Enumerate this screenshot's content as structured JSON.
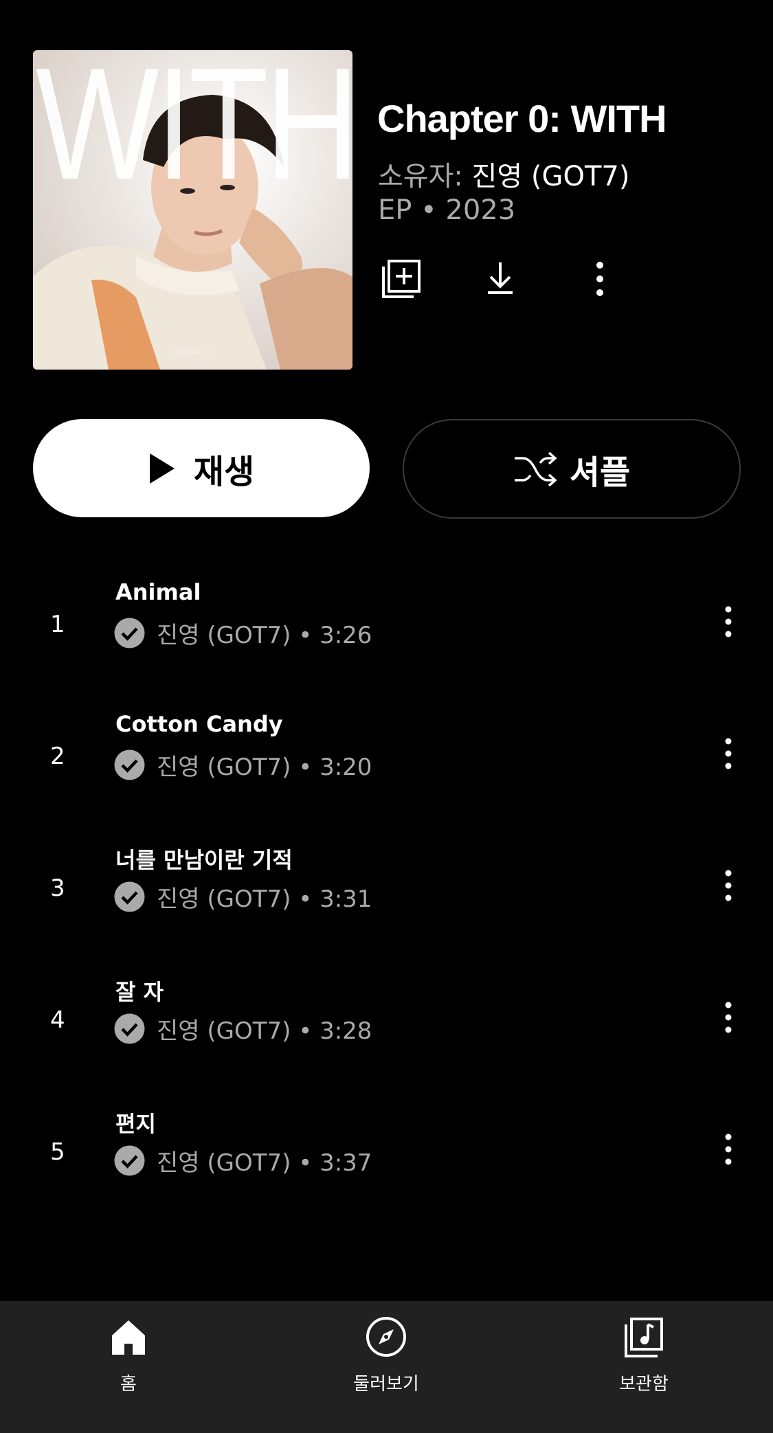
{
  "album": {
    "cover_text": "WITH",
    "cover_caption": "Chapter 0:",
    "title": "Chapter 0: WITH",
    "owner_prefix": "소유자: ",
    "owner_name": "진영 (GOT7)",
    "meta": "EP • 2023",
    "actions": [
      {
        "icon": "add-to-library-icon"
      },
      {
        "icon": "download-icon"
      },
      {
        "icon": "more-vert-icon"
      }
    ]
  },
  "buttons": {
    "play_label": "재생",
    "shuffle_label": "셔플"
  },
  "tracks": [
    {
      "number": "1",
      "title": "Animal",
      "sub": "진영 (GOT7) • 3:26"
    },
    {
      "number": "2",
      "title": "Cotton Candy",
      "sub": "진영 (GOT7) • 3:20"
    },
    {
      "number": "3",
      "title": "너를 만남이란 기적",
      "sub": "진영 (GOT7) • 3:31"
    },
    {
      "number": "4",
      "title": "잘 자",
      "sub": "진영 (GOT7) • 3:28"
    },
    {
      "number": "5",
      "title": "편지",
      "sub": "진영 (GOT7) • 3:37"
    }
  ],
  "nav": {
    "items": [
      {
        "label": "홈",
        "icon": "home-icon"
      },
      {
        "label": "둘러보기",
        "icon": "explore-compass-icon"
      },
      {
        "label": "보관함",
        "icon": "library-music-icon"
      }
    ]
  },
  "colors": {
    "background": "#000000",
    "nav_background": "#212121",
    "secondary_text": "#aaaaaa",
    "verified_badge": "#aaaaaa"
  }
}
